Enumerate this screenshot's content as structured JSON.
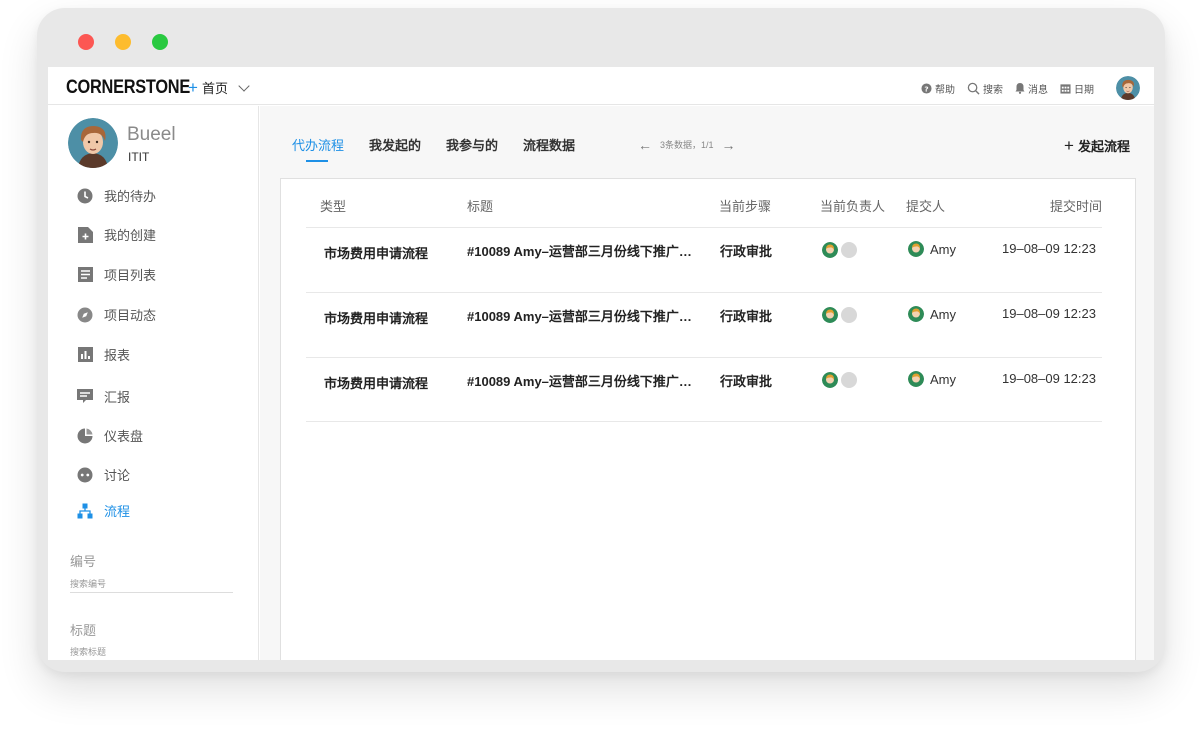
{
  "window": {
    "buttons": [
      "close",
      "minimize",
      "maximize"
    ]
  },
  "topbar": {
    "logo": "CORNERSTONE",
    "home_label": "首页",
    "help_label": "帮助",
    "search_label": "搜索",
    "messages_label": "消息",
    "calendar_label": "日期"
  },
  "profile": {
    "name": "Bueel",
    "team": "ITIT"
  },
  "sidebar": {
    "items": [
      {
        "label": "我的待办",
        "icon": "clock-icon"
      },
      {
        "label": "我的创建",
        "icon": "add-doc-icon"
      },
      {
        "label": "项目列表",
        "icon": "list-doc-icon"
      },
      {
        "label": "项目动态",
        "icon": "compass-icon"
      },
      {
        "label": "报表",
        "icon": "bar-chart-icon"
      },
      {
        "label": "汇报",
        "icon": "comment-icon"
      },
      {
        "label": "仪表盘",
        "icon": "pie-icon"
      },
      {
        "label": "讨论",
        "icon": "chat-dots-icon"
      },
      {
        "label": "流程",
        "icon": "flow-icon",
        "active": true
      }
    ],
    "filters": {
      "number_label": "编号",
      "number_placeholder": "搜索编号",
      "title_label": "标题",
      "title_placeholder": "搜索标题"
    }
  },
  "main": {
    "tabs": [
      "代办流程",
      "我发起的",
      "我参与的",
      "流程数据"
    ],
    "active_tab": 0,
    "pager_text": "3条数据，1/1",
    "start_flow_label": "发起流程",
    "table": {
      "headers": [
        "类型",
        "标题",
        "当前步骤",
        "当前负责人",
        "提交人",
        "提交时间"
      ],
      "rows": [
        {
          "type": "市场费用申请流程",
          "title": "#10089 Amy–运营部三月份线下推广…",
          "step": "行政审批",
          "submitter": "Amy",
          "time": "19–08–09 12:23"
        },
        {
          "type": "市场费用申请流程",
          "title": "#10089 Amy–运营部三月份线下推广…",
          "step": "行政审批",
          "submitter": "Amy",
          "time": "19–08–09 12:23"
        },
        {
          "type": "市场费用申请流程",
          "title": "#10089 Amy–运营部三月份线下推广…",
          "step": "行政审批",
          "submitter": "Amy",
          "time": "19–08–09 12:23"
        }
      ]
    }
  },
  "colors": {
    "accent": "#1e90e6",
    "close": "#fc5753",
    "minimize": "#fdbc2e",
    "maximize": "#29c940"
  }
}
